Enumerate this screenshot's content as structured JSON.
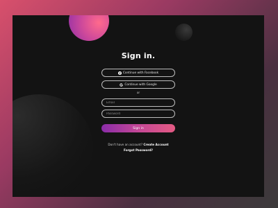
{
  "page": {
    "title": "Sign in.",
    "accent_gradient": [
      "#8a2ca8",
      "#c44796",
      "#e35a83"
    ],
    "background_gradient": [
      "#d8506c",
      "#9a3a62",
      "#4a3040",
      "#3c3a3b"
    ],
    "card_color": "#131313"
  },
  "social": {
    "facebook_label": "Continue with Facebook",
    "facebook_icon": "facebook-icon",
    "google_label": "Continue with Google",
    "google_icon": "google-icon"
  },
  "divider": {
    "label": "or"
  },
  "form": {
    "email_placeholder": "Email",
    "email_value": "",
    "password_placeholder": "Password",
    "password_value": "",
    "submit_label": "Sign in"
  },
  "footer": {
    "account_prompt": "Don't have an account?",
    "create_label": "Create Account",
    "forgot_label": "Forgot Password?"
  }
}
